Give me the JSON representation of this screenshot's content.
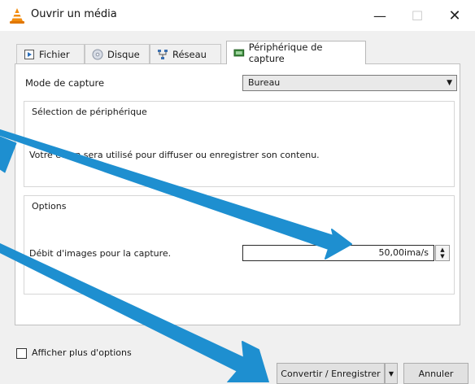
{
  "window": {
    "title": "Ouvrir un média",
    "controls": {
      "minimize": "—",
      "maximize": "☐",
      "close": "✕"
    }
  },
  "tabs": [
    {
      "label": "Fichier",
      "icon": "file-icon"
    },
    {
      "label": "Disque",
      "icon": "disc-icon"
    },
    {
      "label": "Réseau",
      "icon": "network-icon"
    },
    {
      "label": "Périphérique de capture",
      "icon": "capture-device-icon",
      "active": true
    }
  ],
  "capture": {
    "mode_label": "Mode de capture",
    "mode_value": "Bureau"
  },
  "device_group": {
    "title": "Sélection de périphérique",
    "text": "Votre écran sera utilisé pour diffuser ou enregistrer son contenu."
  },
  "options_group": {
    "title": "Options",
    "rate_label": "Débit d'images pour la capture.",
    "rate_value": "50,00ima/s"
  },
  "footer": {
    "more_options_label": "Afficher plus d'options",
    "more_options_checked": false,
    "convert_label": "Convertir / Enregistrer",
    "cancel_label": "Annuler"
  },
  "colors": {
    "annotation_arrow": "#1e8fd0",
    "accent": "#e8750a"
  }
}
